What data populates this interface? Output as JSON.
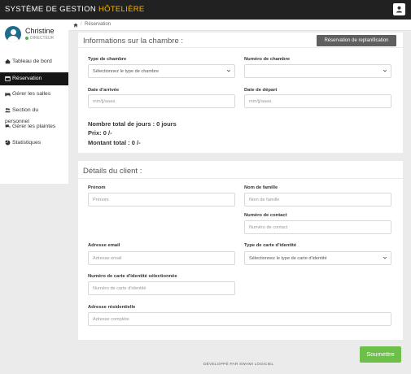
{
  "app": {
    "title_main": "SYSTÈME DE GESTION ",
    "title_accent": "HÔTELIÈRE"
  },
  "colors": {
    "accent": "#f5b400",
    "topbar": "#212121",
    "active_nav": "#161616",
    "submit": "#6cc04a"
  },
  "user": {
    "name": "Christine",
    "role": "DIRECTEUR",
    "avatar_icon": "user-avatar-icon"
  },
  "sidebar": {
    "items": [
      {
        "label": "Tableau de bord",
        "icon": "dashboard-icon"
      },
      {
        "label": "Réservation",
        "icon": "calendar-icon",
        "active": true
      },
      {
        "label": "Gérer les salles",
        "icon": "bed-icon"
      },
      {
        "label": "Section du",
        "label2": "personnel",
        "icon": "users-icon"
      },
      {
        "label": "Gérer les plaintes",
        "icon": "comments-icon"
      },
      {
        "label": "Statistiques",
        "icon": "chart-icon"
      }
    ]
  },
  "breadcrumb": {
    "current": "Réservation",
    "home_icon": "home-icon"
  },
  "room": {
    "title": "Informations sur la chambre :",
    "reschedule_label": "Réservation de replanification",
    "room_type_label": "Type de chambre",
    "room_type_value": "Sélectionnez le type de chambre",
    "room_number_label": "Numéro de chambre",
    "room_number_value": "",
    "arrival_label": "Date d'arrivée",
    "arrival_placeholder": "mm/jj/aaaa",
    "departure_label": "Date de départ",
    "departure_placeholder": "mm/jj/aaaa",
    "total_days": "Nombre total de jours : 0 jours",
    "price": "Prix: 0 /-",
    "total_amount": "Montant total : 0 /-"
  },
  "client": {
    "title": "Détails du client :",
    "first_name_label": "Prénom",
    "first_name_placeholder": "Prénom",
    "last_name_label": "Nom de famille",
    "last_name_placeholder": "Nom de famille",
    "contact_label": "Numéro de contact",
    "contact_placeholder": "Numéro de contact",
    "email_label": "Adresse email",
    "email_placeholder": "Adresse email",
    "id_type_label": "Type de carte d'identité",
    "id_type_value": "Sélectionnez le type de carte d'identité",
    "id_number_label": "Numéro de carte d'identité sélectionnée",
    "id_number_placeholder": "Numéro de carte d'identité",
    "address_label": "Adresse résidentielle",
    "address_placeholder": "Adresse complète"
  },
  "actions": {
    "submit_label": "Soumettre"
  },
  "footer": {
    "text": "DÉVELOPPÉ PAR SWAMI LOGICIEL"
  }
}
